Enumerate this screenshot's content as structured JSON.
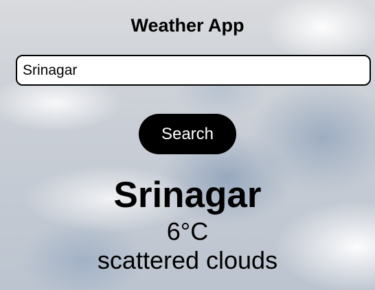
{
  "app": {
    "title": "Weather App"
  },
  "search": {
    "value": "Srinagar",
    "button_label": "Search"
  },
  "result": {
    "city": "Srinagar",
    "temperature": "6°C",
    "description": "scattered clouds"
  }
}
